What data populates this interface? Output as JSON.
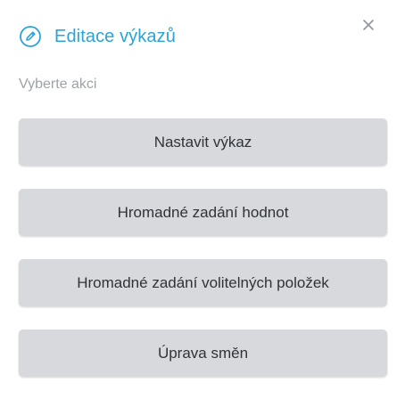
{
  "dialog": {
    "title": "Editace výkazů",
    "title_icon": "pencil-circle-icon",
    "close_label": "×",
    "close_icon": "close-icon",
    "subtitle": "Vyberte akci",
    "accent_color": "#2ba3d6"
  },
  "actions": [
    {
      "label": "Nastavit výkaz"
    },
    {
      "label": "Hromadné zadání hodnot"
    },
    {
      "label": "Hromadné zadání volitelných položek"
    },
    {
      "label": "Úprava směn"
    }
  ]
}
